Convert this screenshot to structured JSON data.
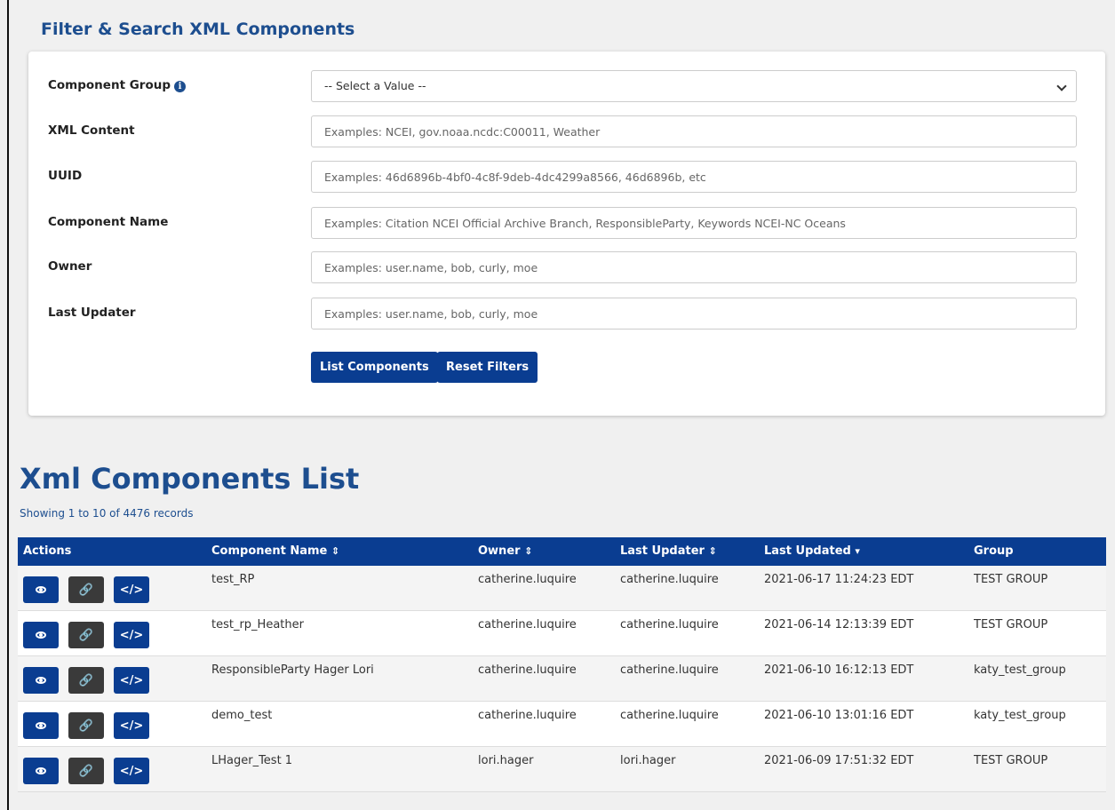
{
  "filter": {
    "title": "Filter & Search XML Components",
    "fields": [
      {
        "label": "Component Group",
        "value": "-- Select a Value --",
        "placeholder": "",
        "info": "i"
      },
      {
        "label": "XML Content",
        "placeholder": "Examples: NCEI, gov.noaa.ncdc:C00011, Weather"
      },
      {
        "label": "UUID",
        "placeholder": "Examples: 46d6896b-4bf0-4c8f-9deb-4dc4299a8566, 46d6896b, etc"
      },
      {
        "label": "Component Name",
        "placeholder": "Examples: Citation NCEI Official Archive Branch, ResponsibleParty, Keywords NCEI-NC Oceans"
      },
      {
        "label": "Owner",
        "placeholder": "Examples: user.name, bob, curly, moe"
      },
      {
        "label": "Last Updater",
        "placeholder": "Examples: user.name, bob, curly, moe"
      }
    ],
    "list_button": "List Components",
    "reset_button": "Reset Filters"
  },
  "list": {
    "title": "Xml Components List",
    "showing": "Showing 1 to 10 of 4476 records",
    "columns": {
      "actions": "Actions",
      "name": "Component Name",
      "owner": "Owner",
      "updater": "Last Updater",
      "updated": "Last Updated",
      "group": "Group",
      "sort_both": "⇕",
      "sort_desc": "▾"
    },
    "rows": [
      {
        "name": "test_RP",
        "owner": "catherine.luquire",
        "updater": "catherine.luquire",
        "updated": "2021-06-17 11:24:23 EDT",
        "group": "TEST GROUP"
      },
      {
        "name": "test_rp_Heather",
        "owner": "catherine.luquire",
        "updater": "catherine.luquire",
        "updated": "2021-06-14 12:13:39 EDT",
        "group": "TEST GROUP"
      },
      {
        "name": "ResponsibleParty Hager Lori",
        "owner": "catherine.luquire",
        "updater": "catherine.luquire",
        "updated": "2021-06-10 16:12:13 EDT",
        "group": "katy_test_group"
      },
      {
        "name": "demo_test",
        "owner": "catherine.luquire",
        "updater": "catherine.luquire",
        "updated": "2021-06-10 13:01:16 EDT",
        "group": "katy_test_group"
      },
      {
        "name": "LHager_Test 1",
        "owner": "lori.hager",
        "updater": "lori.hager",
        "updated": "2021-06-09 17:51:32 EDT",
        "group": "TEST GROUP"
      }
    ],
    "icons": {
      "link": "🔗",
      "code": "</>"
    }
  },
  "colors": {
    "primary": "#0a3d91",
    "title": "#1d4e8f",
    "dark_button": "#3a3a3a"
  }
}
